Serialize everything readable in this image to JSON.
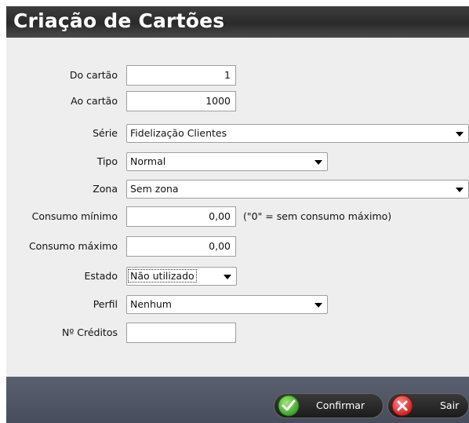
{
  "window": {
    "title": "Criação de Cartões"
  },
  "form": {
    "do_cartao": {
      "label": "Do cartão",
      "value": "1"
    },
    "ao_cartao": {
      "label": "Ao cartão",
      "value": "1000"
    },
    "serie": {
      "label": "Série",
      "value": "Fidelização Clientes"
    },
    "tipo": {
      "label": "Tipo",
      "value": "Normal"
    },
    "zona": {
      "label": "Zona",
      "value": "Sem zona"
    },
    "consumo_minimo": {
      "label": "Consumo mínimo",
      "value": "0,00",
      "note": "(\"0\" = sem consumo máximo)"
    },
    "consumo_maximo": {
      "label": "Consumo máximo",
      "value": "0,00"
    },
    "estado": {
      "label": "Estado",
      "value": "Não utilizado"
    },
    "perfil": {
      "label": "Perfil",
      "value": "Nenhum"
    },
    "n_creditos": {
      "label": "Nº Créditos",
      "value": ""
    }
  },
  "buttons": {
    "confirm": "Confirmar",
    "exit": "Sair"
  },
  "colors": {
    "confirm_icon": "#3fae2a",
    "exit_icon": "#e02020",
    "title_bar": "#2f2f2f",
    "bottom_bar": "#4f5565"
  },
  "icons": {
    "confirm": "check-icon",
    "exit": "close-icon"
  }
}
